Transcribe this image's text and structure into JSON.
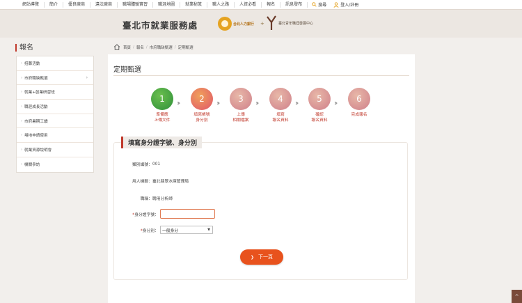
{
  "topnav": {
    "items": [
      "網站導覽",
      "簡介",
      "優良廠商",
      "違法廠商",
      "職場體驗實習",
      "職涯地圖",
      "就業秘笈",
      "職人之路",
      "人資必看",
      "報名",
      "訊息發布"
    ],
    "search_label": "搜尋",
    "login_label": "登入/註冊"
  },
  "banner": {
    "title": "臺北市就業服務處",
    "logo1_label": "台北人力銀行",
    "plus": "+",
    "logo2_label": "臺北青年職涯發展中心"
  },
  "sidebar": {
    "title": "報名",
    "items": [
      {
        "label": "招募活動"
      },
      {
        "label": "市府職缺甄選"
      },
      {
        "label": "就業+創業研習班"
      },
      {
        "label": "職涯成長活動"
      },
      {
        "label": "市府暑期工讀"
      },
      {
        "label": "場地申請使用"
      },
      {
        "label": "就業資源說明會"
      },
      {
        "label": "機關參訪"
      }
    ]
  },
  "breadcrumb": [
    "首頁",
    "報名",
    "市府職缺甄選",
    "定期甄選"
  ],
  "page": {
    "title": "定期甄選"
  },
  "steps": [
    {
      "num": "1",
      "label": "準備應\n上傳文件",
      "color": "#3aa34a"
    },
    {
      "num": "2",
      "label": "填寫帳號\n身分別",
      "color": "#e77a5a"
    },
    {
      "num": "3",
      "label": "上傳\n相關檔案",
      "color": "#d9a0a0"
    },
    {
      "num": "4",
      "label": "填寫\n報名資料",
      "color": "#d9a0a0"
    },
    {
      "num": "5",
      "label": "確認\n報名資料",
      "color": "#d9a0a0"
    },
    {
      "num": "6",
      "label": "完成報名",
      "color": "#d9a0a0"
    }
  ],
  "form": {
    "section_title": "填寫身分證字號、身分別",
    "category_label": "類別編號：",
    "category_value": "001",
    "employer_label": "用人機關：",
    "employer_value": "臺北翡翠水庫管理局",
    "position_label": "職稱：",
    "position_value": "聘用分析師",
    "id_required": "*",
    "id_label": "身分證字號：",
    "id_value": "",
    "identity_required": "*",
    "identity_label": "身分別：",
    "identity_value": "一般身分",
    "next_label": "下一頁"
  },
  "totop_label": "^"
}
